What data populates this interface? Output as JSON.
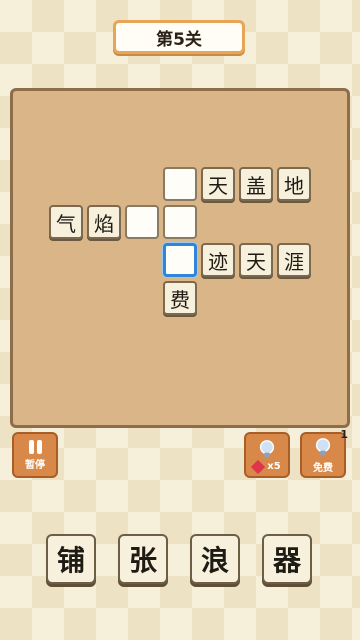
{
  "level": {
    "title": "第5关"
  },
  "board": {
    "cells": [
      {
        "id": "r0c0",
        "char": ""
      },
      {
        "id": "r0c1",
        "char": "天"
      },
      {
        "id": "r0c2",
        "char": "盖"
      },
      {
        "id": "r0c3",
        "char": "地"
      },
      {
        "id": "r1c0",
        "char": "气"
      },
      {
        "id": "r1c1",
        "char": "焰"
      },
      {
        "id": "r1c2",
        "char": ""
      },
      {
        "id": "r1c3",
        "char": ""
      },
      {
        "id": "r2c0",
        "char": "",
        "selected": true
      },
      {
        "id": "r2c1",
        "char": "迹"
      },
      {
        "id": "r2c2",
        "char": "天"
      },
      {
        "id": "r2c3",
        "char": "涯"
      },
      {
        "id": "r3c0",
        "char": "费"
      }
    ]
  },
  "controls": {
    "pause_label": "暂停",
    "hint_cost_label": "x5",
    "free_label": "免费",
    "free_count": "1"
  },
  "answers": [
    "铺",
    "张",
    "浪",
    "器"
  ],
  "colors": {
    "accent": "#d8894a",
    "selected_border": "#2e86d6",
    "board": "#d9b588"
  }
}
